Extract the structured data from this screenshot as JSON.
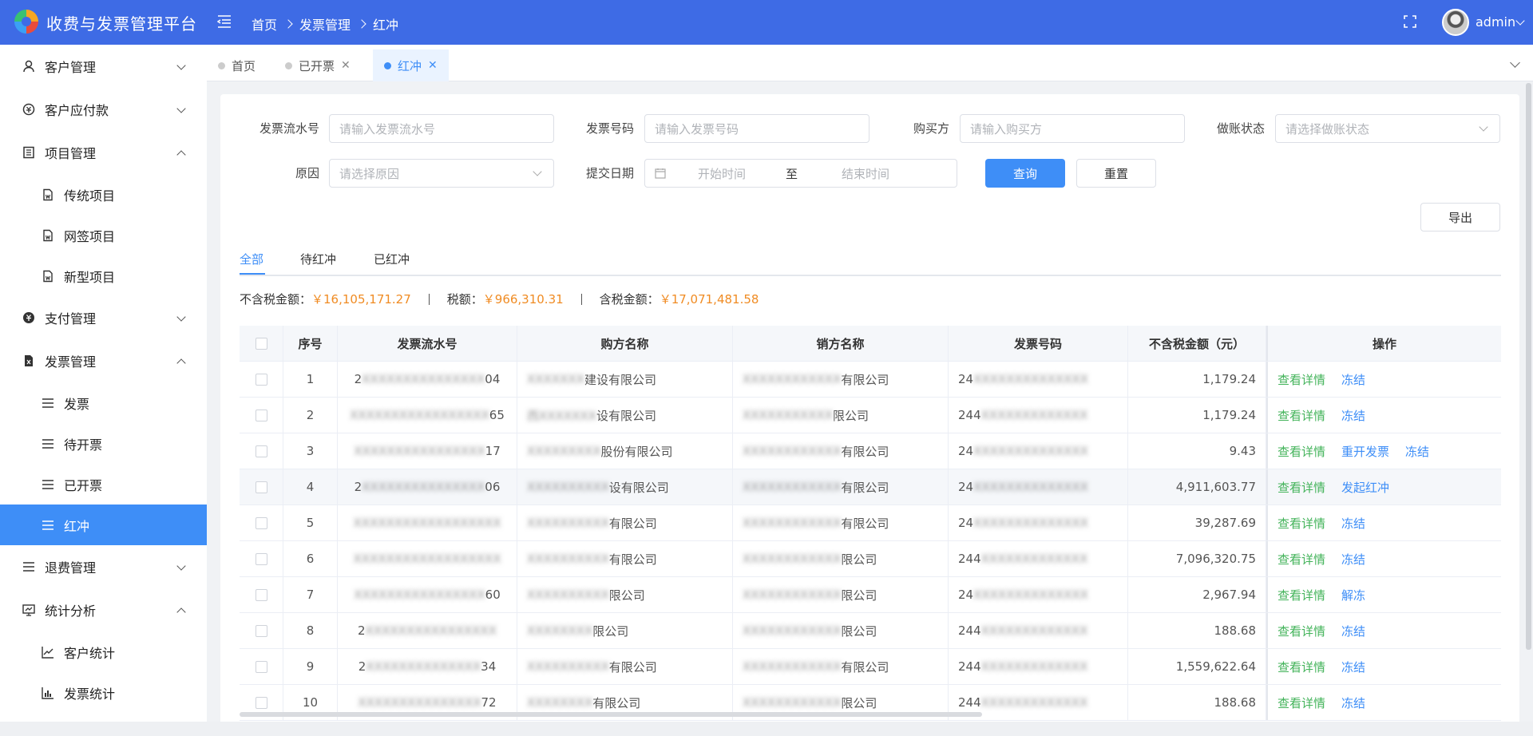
{
  "header": {
    "app_title": "收费与发票管理平台",
    "breadcrumb": [
      "首页",
      "发票管理",
      "红冲"
    ],
    "username": "admin",
    "brand_color": "#3e6be5"
  },
  "sidebar": {
    "items": [
      {
        "label": "客户管理",
        "icon": "user-icon"
      },
      {
        "label": "客户应付款",
        "icon": "money-icon"
      },
      {
        "label": "项目管理",
        "icon": "list-icon"
      },
      {
        "label": "传统项目",
        "icon": "doc-icon"
      },
      {
        "label": "网签项目",
        "icon": "doc-icon"
      },
      {
        "label": "新型项目",
        "icon": "doc-icon"
      },
      {
        "label": "支付管理",
        "icon": "pay-icon"
      },
      {
        "label": "发票管理",
        "icon": "invoice-icon"
      },
      {
        "label": "发票",
        "icon": "menu-icon"
      },
      {
        "label": "待开票",
        "icon": "menu-icon"
      },
      {
        "label": "已开票",
        "icon": "menu-icon"
      },
      {
        "label": "红冲",
        "icon": "menu-icon"
      },
      {
        "label": "退费管理",
        "icon": "menu-icon"
      },
      {
        "label": "统计分析",
        "icon": "chart-icon"
      },
      {
        "label": "客户统计",
        "icon": "line-chart-icon"
      },
      {
        "label": "发票统计",
        "icon": "bar-chart-icon"
      }
    ],
    "active_color": "#3e8ef7"
  },
  "tabs": [
    {
      "label": "首页"
    },
    {
      "label": "已开票"
    },
    {
      "label": "红冲"
    }
  ],
  "filters": {
    "serial_label": "发票流水号",
    "serial_placeholder": "请输入发票流水号",
    "invoice_no_label": "发票号码",
    "invoice_no_placeholder": "请输入发票号码",
    "buyer_label": "购买方",
    "buyer_placeholder": "请输入购买方",
    "account_label": "做账状态",
    "account_placeholder": "请选择做账状态",
    "reason_label": "原因",
    "reason_placeholder": "请选择原因",
    "date_label": "提交日期",
    "date_start": "开始时间",
    "date_to": "至",
    "date_end": "结束时间",
    "query_btn": "查询",
    "reset_btn": "重置",
    "export_btn": "导出"
  },
  "status_tabs": [
    "全部",
    "待红冲",
    "已红冲"
  ],
  "summary": {
    "pretax_label": "不含税金额：",
    "pretax_value": "￥16,105,171.27",
    "tax_label": "税额：",
    "tax_value": "￥966,310.31",
    "total_label": "含税金额：",
    "total_value": "￥17,071,481.58",
    "accent": "#f08c24"
  },
  "table": {
    "headers": [
      "序号",
      "发票流水号",
      "购方名称",
      "销方名称",
      "发票号码",
      "不含税金额（元）",
      "操作"
    ],
    "rows": [
      {
        "idx": "1",
        "sn_head": "2",
        "sn_mask": "XXXXXXXXXXXXXXX",
        "sn_tail": "04",
        "buyer_mask": "XXXXXXX",
        "buyer_tail": "建设有限公司",
        "seller_mask": "XXXXXXXXXXXX",
        "seller_tail": "有限公司",
        "no_head": "24",
        "no_mask": "XXXXXXXXXXXXXX",
        "amount": "1,179.24",
        "ops": [
          "查看详情",
          "冻结"
        ]
      },
      {
        "idx": "2",
        "sn_head": "",
        "sn_mask": "XXXXXXXXXXXXXXXXX",
        "sn_tail": "65",
        "buyer_mask": "西XXXXXXX",
        "buyer_tail": "设有限公司",
        "seller_mask": "XXXXXXXXXXX",
        "seller_tail": "限公司",
        "no_head": "244",
        "no_mask": "XXXXXXXXXXXXX",
        "amount": "1,179.24",
        "ops": [
          "查看详情",
          "冻结"
        ]
      },
      {
        "idx": "3",
        "sn_head": "",
        "sn_mask": "XXXXXXXXXXXXXXXX",
        "sn_tail": "17",
        "buyer_mask": "XXXXXXXXX",
        "buyer_tail": "股份有限公司",
        "seller_mask": "XXXXXXXXXXXX",
        "seller_tail": "有限公司",
        "no_head": "24",
        "no_mask": "XXXXXXXXXXXXXX",
        "amount": "9.43",
        "ops": [
          "查看详情",
          "重开发票",
          "冻结"
        ]
      },
      {
        "idx": "4",
        "sn_head": "2",
        "sn_mask": "XXXXXXXXXXXXXXX",
        "sn_tail": "06",
        "buyer_mask": "XXXXXXXXXX",
        "buyer_tail": "设有限公司",
        "seller_mask": "XXXXXXXXXXXX",
        "seller_tail": "有限公司",
        "no_head": "24",
        "no_mask": "XXXXXXXXXXXXXX",
        "amount": "4,911,603.77",
        "ops": [
          "查看详情",
          "发起红冲"
        ]
      },
      {
        "idx": "5",
        "sn_head": "",
        "sn_mask": "XXXXXXXXXXXXXXXXXX",
        "sn_tail": "",
        "buyer_mask": "XXXXXXXXXX",
        "buyer_tail": "有限公司",
        "seller_mask": "XXXXXXXXXXXX",
        "seller_tail": "有限公司",
        "no_head": "24",
        "no_mask": "XXXXXXXXXXXXXX",
        "amount": "39,287.69",
        "ops": [
          "查看详情",
          "冻结"
        ]
      },
      {
        "idx": "6",
        "sn_head": "",
        "sn_mask": "XXXXXXXXXXXXXXXXXX",
        "sn_tail": "",
        "buyer_mask": "XXXXXXXXXX",
        "buyer_tail": "有限公司",
        "seller_mask": "XXXXXXXXXXXX",
        "seller_tail": "限公司",
        "no_head": "244",
        "no_mask": "XXXXXXXXXXXXX",
        "amount": "7,096,320.75",
        "ops": [
          "查看详情",
          "冻结"
        ]
      },
      {
        "idx": "7",
        "sn_head": "",
        "sn_mask": "XXXXXXXXXXXXXXXX",
        "sn_tail": "60",
        "buyer_mask": "XXXXXXXXXX",
        "buyer_tail": "限公司",
        "seller_mask": "XXXXXXXXXXXX",
        "seller_tail": "限公司",
        "no_head": "24",
        "no_mask": "XXXXXXXXXXXXXX",
        "amount": "2,967.94",
        "ops": [
          "查看详情",
          "解冻"
        ]
      },
      {
        "idx": "8",
        "sn_head": "2",
        "sn_mask": "XXXXXXXXXXXXXXXX",
        "sn_tail": "",
        "buyer_mask": "XXXXXXXX",
        "buyer_tail": "限公司",
        "seller_mask": "XXXXXXXXXXXX",
        "seller_tail": "限公司",
        "no_head": "244",
        "no_mask": "XXXXXXXXXXXXX",
        "amount": "188.68",
        "ops": [
          "查看详情",
          "冻结"
        ]
      },
      {
        "idx": "9",
        "sn_head": "2",
        "sn_mask": "XXXXXXXXXXXXXX",
        "sn_tail": "34",
        "buyer_mask": "XXXXXXXXXX",
        "buyer_tail": "有限公司",
        "seller_mask": "XXXXXXXXXXXX",
        "seller_tail": "有限公司",
        "no_head": "244",
        "no_mask": "XXXXXXXXXXXXX",
        "amount": "1,559,622.64",
        "ops": [
          "查看详情",
          "冻结"
        ]
      },
      {
        "idx": "10",
        "sn_head": "",
        "sn_mask": "XXXXXXXXXXXXXXX",
        "sn_tail": "72",
        "buyer_mask": "XXXXXXXX",
        "buyer_tail": "有限公司",
        "seller_mask": "XXXXXXXXXXXX",
        "seller_tail": "限公司",
        "no_head": "244",
        "no_mask": "XXXXXXXXXXXXX",
        "amount": "188.68",
        "ops": [
          "查看详情",
          "冻结"
        ]
      }
    ]
  }
}
